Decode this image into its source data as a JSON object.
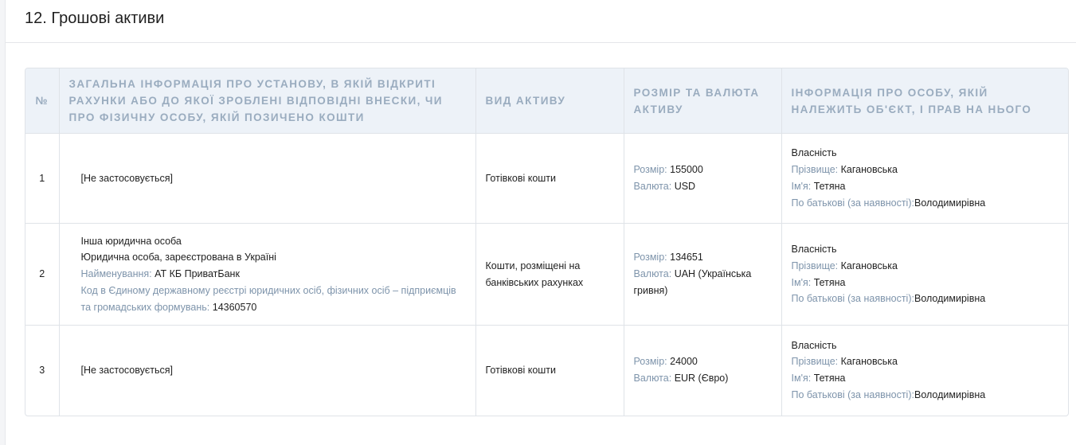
{
  "section": {
    "title": "12. Грошові активи"
  },
  "table": {
    "headers": {
      "num": "№",
      "institution": "Загальна інформація про установу, в якій відкриті рахунки або до якої зроблені відповідні внески, чи про фізичну особу, якій позичено кошти",
      "asset_type": "Вид активу",
      "amount": "Розмір та валюта активу",
      "owner": "Інформація про особу, якій належить об'єкт, і прав на нього"
    },
    "labels": {
      "size": "Розмір:",
      "currency": "Валюта:",
      "surname": "Прізвище:",
      "name": "Ім'я:",
      "patronymic": "По батькові (за наявності):",
      "institution_name": "Найменування:",
      "edrpou": "Код в Єдиному державному реєстрі юридичних осіб, фізичних осіб – підприємців та громадських формувань:"
    },
    "rows": [
      {
        "num": "1",
        "institution": "[Не застосовується]",
        "asset_type": "Готівкові кошти",
        "size": "155000",
        "currency": "USD",
        "ownership": "Власність",
        "surname": "Кагановська",
        "name": "Тетяна",
        "patronymic": "Володимирівна"
      },
      {
        "num": "2",
        "institution_line1": "Інша юридична особа",
        "institution_line2": "Юридична особа, зареєстрована в Україні",
        "institution_name": "АТ КБ ПриватБанк",
        "edrpou": "14360570",
        "asset_type": "Кошти, розміщені на банківських рахунках",
        "size": "134651",
        "currency": "UAH (Українська гривня)",
        "ownership": "Власність",
        "surname": "Кагановська",
        "name": "Тетяна",
        "patronymic": "Володимирівна"
      },
      {
        "num": "3",
        "institution": "[Не застосовується]",
        "asset_type": "Готівкові кошти",
        "size": "24000",
        "currency": "EUR (Євро)",
        "ownership": "Власність",
        "surname": "Кагановська",
        "name": "Тетяна",
        "patronymic": "Володимирівна"
      }
    ]
  }
}
